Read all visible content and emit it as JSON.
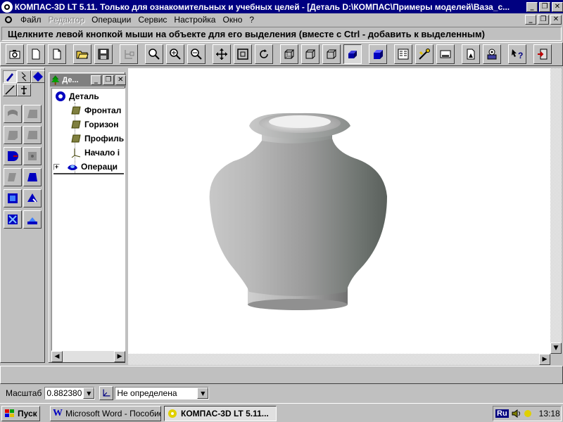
{
  "window": {
    "title": "КОМПАС-3D LT 5.11. Только для ознакомительных и учебных целей - [Деталь D:\\КОМПАС\\Примеры моделей\\Ваза_с...",
    "minimize_glyph": "_",
    "restore_glyph": "❐",
    "close_glyph": "✕"
  },
  "menu": {
    "items": [
      {
        "label": "Файл",
        "enabled": true
      },
      {
        "label": "Редактор",
        "enabled": false
      },
      {
        "label": "Операции",
        "enabled": true
      },
      {
        "label": "Сервис",
        "enabled": true
      },
      {
        "label": "Настройка",
        "enabled": true
      },
      {
        "label": "Окно",
        "enabled": true
      },
      {
        "label": "?",
        "enabled": true
      }
    ]
  },
  "prompt": {
    "text": "Щелкните левой кнопкой мыши на объекте для его выделения (вместе с Ctrl - добавить к выделенным)"
  },
  "toolbar": {
    "buttons": [
      {
        "icon": "camera-icon",
        "tooltip": ""
      },
      {
        "icon": "new-document-icon"
      },
      {
        "icon": "new-file-icon"
      },
      {
        "icon": "open-folder-icon"
      },
      {
        "icon": "save-icon"
      },
      {
        "icon": "tree-structure-icon"
      },
      {
        "icon": "zoom-icon"
      },
      {
        "icon": "zoom-in-icon"
      },
      {
        "icon": "zoom-out-icon"
      },
      {
        "icon": "pan-icon"
      },
      {
        "icon": "fit-view-icon"
      },
      {
        "icon": "rotate-icon"
      },
      {
        "icon": "wireframe-icon"
      },
      {
        "icon": "hidden-lines-icon"
      },
      {
        "icon": "thin-hidden-lines-icon"
      },
      {
        "icon": "shaded-icon"
      },
      {
        "icon": "perspective-icon"
      },
      {
        "icon": "properties-icon"
      },
      {
        "icon": "material-icon"
      },
      {
        "icon": "measure-icon"
      },
      {
        "icon": "mass-properties-icon"
      },
      {
        "icon": "libraries-icon"
      },
      {
        "icon": "help-icon"
      },
      {
        "icon": "exit-icon"
      }
    ]
  },
  "tree": {
    "title": "Де...",
    "root": "Деталь",
    "items": [
      {
        "label": "Фронтал",
        "icon": "plane-icon"
      },
      {
        "label": "Горизон",
        "icon": "plane-icon"
      },
      {
        "label": "Профиль",
        "icon": "plane-icon"
      },
      {
        "label": "Начало і",
        "icon": "origin-icon"
      },
      {
        "label": "Операци",
        "icon": "operation-icon"
      }
    ],
    "expand_glyph": "+"
  },
  "params": {
    "scale_label": "Масштаб",
    "scale_value": "0.882380",
    "orientation_value": "Не определена"
  },
  "taskbar": {
    "start_label": "Пуск",
    "tasks": [
      {
        "label": "Microsoft Word - Пособие..."
      },
      {
        "label": "КОМПАС-3D LT 5.11..."
      }
    ],
    "lang": "Ru",
    "time": "13:18"
  },
  "colors": {
    "title_active": "#000080",
    "title_inactive": "#808080",
    "face": "#c0c0c0",
    "vase": "#a0a0a0"
  }
}
